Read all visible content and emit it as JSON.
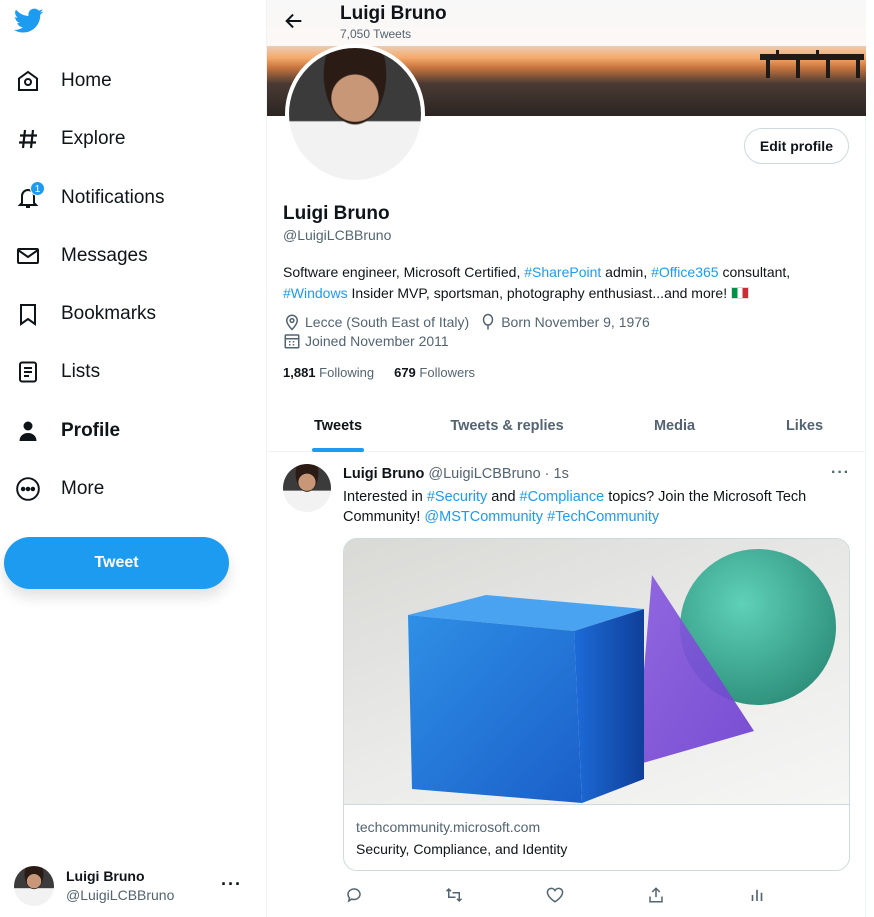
{
  "sidebar": {
    "items": [
      {
        "label": "Home",
        "icon": "home-icon"
      },
      {
        "label": "Explore",
        "icon": "hashtag-icon"
      },
      {
        "label": "Notifications",
        "icon": "bell-icon",
        "badge": "1"
      },
      {
        "label": "Messages",
        "icon": "envelope-icon"
      },
      {
        "label": "Bookmarks",
        "icon": "bookmark-icon"
      },
      {
        "label": "Lists",
        "icon": "list-icon"
      },
      {
        "label": "Profile",
        "icon": "person-icon",
        "active": true
      },
      {
        "label": "More",
        "icon": "more-circle-icon"
      }
    ],
    "tweet_button": "Tweet",
    "account": {
      "name": "Luigi Bruno",
      "handle": "@LuigiLCBBruno"
    }
  },
  "header": {
    "title": "Luigi Bruno",
    "tweet_count": "7,050 Tweets"
  },
  "profile": {
    "name": "Luigi Bruno",
    "handle": "@LuigiLCBBruno",
    "edit_button": "Edit profile",
    "bio": {
      "part1": "Software engineer, Microsoft Certified, ",
      "tag1": "#SharePoint",
      "part2": " admin, ",
      "tag2": "#Office365",
      "part3": " consultant,",
      "tag3": "#Windows",
      "part4": " Insider MVP, sportsman, photography enthusiast...and more! "
    },
    "location": "Lecce (South East of Italy)",
    "birthday": "Born November 9, 1976",
    "joined": "Joined November 2011",
    "following_count": "1,881",
    "following_label": "Following",
    "followers_count": "679",
    "followers_label": "Followers"
  },
  "tabs": [
    "Tweets",
    "Tweets & replies",
    "Media",
    "Likes"
  ],
  "tweet": {
    "author": "Luigi Bruno",
    "handle": "@LuigiLCBBruno",
    "time": "· 1s",
    "text": {
      "part1": "Interested in ",
      "tag1": "#Security",
      "part2": " and ",
      "tag2": "#Compliance",
      "part3": " topics? Join the Microsoft Tech Community! ",
      "mention": "@MSTCommunity",
      "tag3": "#TechCommunity"
    },
    "card_domain": "techcommunity.microsoft.com",
    "card_title": "Security, Compliance, and Identity"
  },
  "colors": {
    "accent": "#1d9bf0",
    "text": "#0f1419",
    "muted": "#536471"
  }
}
